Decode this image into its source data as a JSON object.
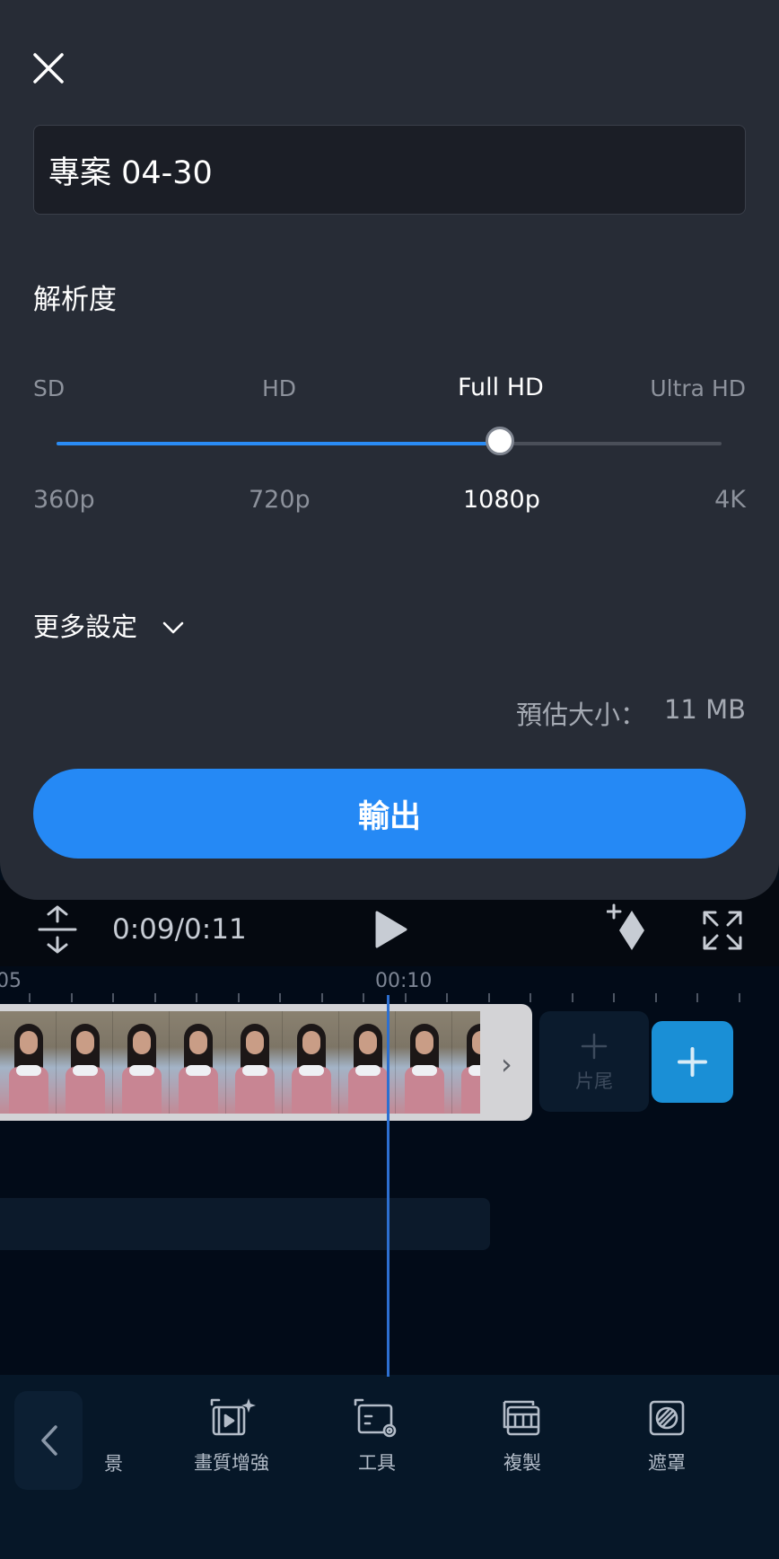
{
  "export_sheet": {
    "project_title": "專案 04-30",
    "resolution_heading": "解析度",
    "resolution_names": [
      "SD",
      "HD",
      "Full HD",
      "Ultra HD"
    ],
    "resolution_values": [
      "360p",
      "720p",
      "1080p",
      "4K"
    ],
    "selected_index": 2,
    "slider_fraction": 0.667,
    "more_settings_label": "更多設定",
    "estimate_label": "預估大小：",
    "estimate_value": "11 MB",
    "export_button_label": "輸出",
    "accent_color": "#2589f5"
  },
  "player": {
    "time_display": "0:09/0:11"
  },
  "timeline": {
    "ruler_labels": [
      "05",
      "00:10"
    ],
    "ending_label": "片尾"
  },
  "toolbar": {
    "partial_label": "景",
    "items": [
      {
        "label": "畫質增強",
        "icon": "enhance-icon"
      },
      {
        "label": "工具",
        "icon": "tools-icon"
      },
      {
        "label": "複製",
        "icon": "duplicate-icon"
      },
      {
        "label": "遮罩",
        "icon": "mask-icon"
      }
    ]
  }
}
